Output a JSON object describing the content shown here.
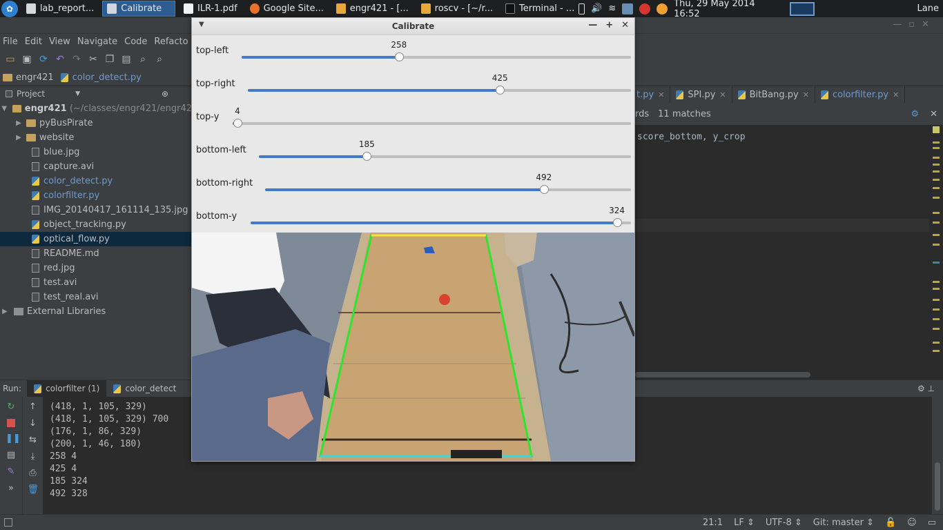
{
  "taskbar": {
    "tasks": [
      {
        "label": "lab_report...",
        "active": false
      },
      {
        "label": "Calibrate",
        "active": true
      },
      {
        "label": "ILR-1.pdf",
        "active": false
      },
      {
        "label": "Google Site...",
        "active": false
      },
      {
        "label": "engr421 - [...",
        "active": false
      },
      {
        "label": "roscv - [~/r...",
        "active": false
      },
      {
        "label": "Terminal - ...",
        "active": false
      }
    ],
    "clock": "Thu, 29 May 2014 16:52",
    "user": "Lane"
  },
  "menu": [
    "File",
    "Edit",
    "View",
    "Navigate",
    "Code",
    "Refacto"
  ],
  "navbar": {
    "project": "engr421",
    "file": "color_detect.py"
  },
  "project_panel": {
    "header": "Project",
    "root": {
      "name": "engr421",
      "path": "(~/classes/engr421/engr42"
    },
    "items": [
      {
        "label": "pyBusPirate",
        "type": "folder"
      },
      {
        "label": "website",
        "type": "folder"
      },
      {
        "label": "blue.jpg",
        "type": "file"
      },
      {
        "label": "capture.avi",
        "type": "file"
      },
      {
        "label": "color_detect.py",
        "type": "py"
      },
      {
        "label": "colorfilter.py",
        "type": "py"
      },
      {
        "label": "IMG_20140417_161114_135.jpg",
        "type": "file"
      },
      {
        "label": "object_tracking.py",
        "type": "py"
      },
      {
        "label": "optical_flow.py",
        "type": "py"
      },
      {
        "label": "README.md",
        "type": "file"
      },
      {
        "label": "red.jpg",
        "type": "file"
      },
      {
        "label": "test.avi",
        "type": "file"
      },
      {
        "label": "test_real.avi",
        "type": "file"
      }
    ],
    "external": "External Libraries"
  },
  "editor": {
    "tabs": [
      "t.py",
      "SPI.py",
      "BitBang.py",
      "colorfilter.py"
    ],
    "search_prefix": "rds",
    "search_matches": "11 matches",
    "code_line": "score_bottom, y_crop"
  },
  "run": {
    "label": "Run:",
    "tabs": [
      "colorfilter (1)",
      "color_detect"
    ],
    "console": [
      "(418, 1, 105, 329)",
      "(418, 1, 105, 329) 700",
      "(176, 1, 86, 329)",
      "(200, 1, 46, 180)",
      "258 4",
      "425 4",
      "185 324",
      "492 328"
    ]
  },
  "status": {
    "position": "21:1",
    "line_sep": "LF",
    "encoding": "UTF-8",
    "vcs": "Git: master"
  },
  "calibrate": {
    "title": "Calibrate",
    "sliders": [
      {
        "label": "top-left",
        "value": "258",
        "fraction": 0.404
      },
      {
        "label": "top-right",
        "value": "425",
        "fraction": 0.658
      },
      {
        "label": "top-y",
        "value": "4",
        "fraction": 0.012
      },
      {
        "label": "bottom-left",
        "value": "185",
        "fraction": 0.29
      },
      {
        "label": "bottom-right",
        "value": "492",
        "fraction": 0.762
      },
      {
        "label": "bottom-y",
        "value": "324",
        "fraction": 0.963
      }
    ]
  }
}
